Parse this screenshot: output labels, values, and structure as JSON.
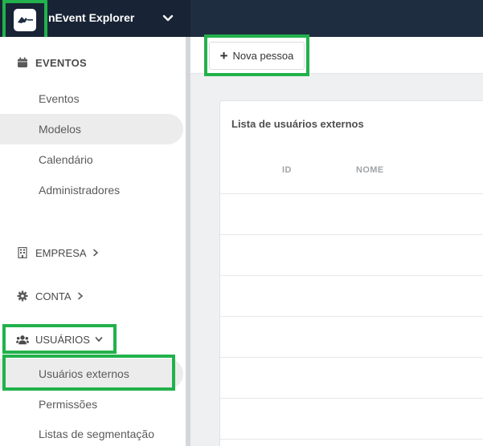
{
  "app": {
    "title": "nEvent Explorer",
    "logo_text": "inEvent"
  },
  "sidebar": {
    "sections": [
      {
        "label": "EVENTOS",
        "icon": "calendar-icon",
        "items": [
          {
            "label": "Eventos"
          },
          {
            "label": "Modelos",
            "active": true
          },
          {
            "label": "Calendário"
          },
          {
            "label": "Administradores"
          }
        ]
      },
      {
        "label": "EMPRESA",
        "icon": "building-icon"
      },
      {
        "label": "CONTA",
        "icon": "gear-icon"
      },
      {
        "label": "USUÁRIOS",
        "icon": "users-icon",
        "expanded": true,
        "items": [
          {
            "label": "Usuários externos",
            "active": true
          },
          {
            "label": "Permissões"
          },
          {
            "label": "Listas de segmentação"
          }
        ]
      }
    ]
  },
  "toolbar": {
    "new_person_label": "Nova pessoa"
  },
  "main": {
    "list_title": "Lista de usuários externos",
    "columns": [
      "ID",
      "NOME"
    ]
  },
  "colors": {
    "topbar": "#1f2d40",
    "highlight": "#22b14c",
    "active_item": "#ececec"
  }
}
